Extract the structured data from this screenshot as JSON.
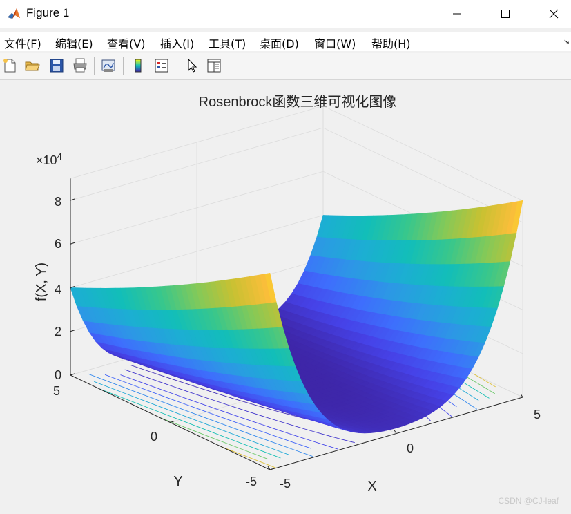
{
  "window": {
    "title": "Figure 1",
    "controls": {
      "minimize": "—",
      "maximize": "☐",
      "close": "✕"
    }
  },
  "menubar": {
    "items": [
      "文件(F)",
      "编辑(E)",
      "查看(V)",
      "插入(I)",
      "工具(T)",
      "桌面(D)",
      "窗口(W)",
      "帮助(H)"
    ],
    "dock_glyph": "↘"
  },
  "toolbar": {
    "buttons": [
      "new-figure",
      "open-file",
      "save-figure",
      "print-figure",
      "link-plot",
      "insert-colorbar",
      "insert-legend",
      "edit-plot",
      "open-property-inspector"
    ]
  },
  "figure": {
    "title": "Rosenbrock函数三维可视化图像",
    "zlabel": "f(X, Y)",
    "xlabel": "X",
    "ylabel": "Y",
    "zexponent_base": "×10",
    "zexponent_power": "4",
    "zticks": [
      "0",
      "2",
      "4",
      "6",
      "8"
    ],
    "xticks": [
      "-5",
      "0",
      "5"
    ],
    "yticks": [
      "-5",
      "0",
      "5"
    ]
  },
  "chart_data": {
    "type": "surface",
    "function": "f(X, Y) = 100(Y − X²)² + (1 − X)²",
    "x_range": [
      -5,
      5
    ],
    "y_range": [
      -5,
      5
    ],
    "z_range": [
      0,
      90000
    ],
    "z_ticks": [
      0,
      20000,
      40000,
      60000,
      80000
    ],
    "colormap": "parula",
    "contour_below": true,
    "grid": true,
    "sample_values": [
      {
        "x": -5,
        "y": -5,
        "z": 90036
      },
      {
        "x": -5,
        "y": 5,
        "z": 40036
      },
      {
        "x": 5,
        "y": -5,
        "z": 90016
      },
      {
        "x": 5,
        "y": 5,
        "z": 40016
      },
      {
        "x": 0,
        "y": 0,
        "z": 1
      },
      {
        "x": 1,
        "y": 1,
        "z": 0
      }
    ]
  },
  "watermark": "CSDN @CJ-leaf"
}
